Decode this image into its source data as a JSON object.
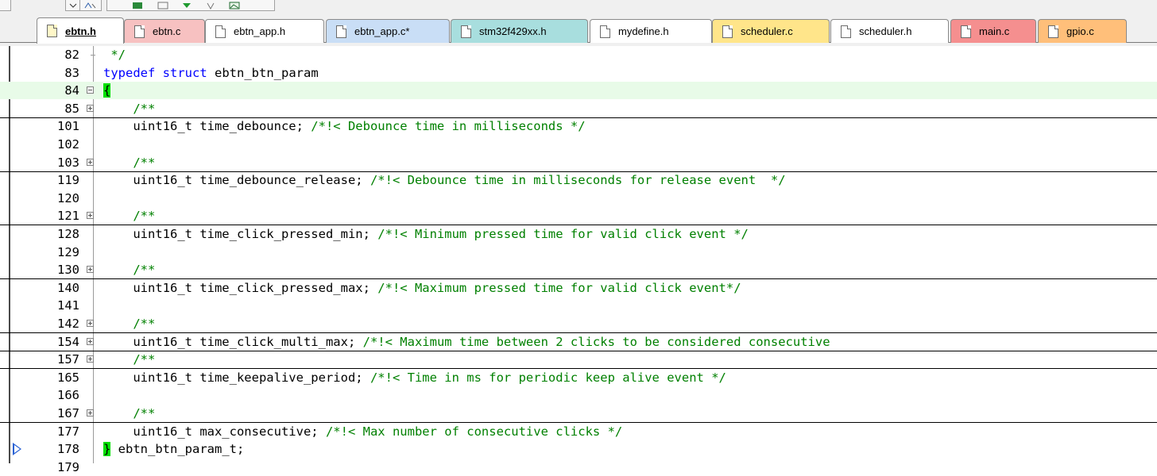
{
  "toolbar": {
    "buttons": [
      "dropdown-icon",
      "find-replace-icon",
      "window-icon",
      "tile-icon",
      "step-down-icon",
      "pin-icon",
      "image-icon"
    ]
  },
  "tabs": [
    {
      "label": "ebtn.h",
      "color": "#fffbf0",
      "active": true
    },
    {
      "label": "ebtn.c",
      "color": "#f7c1c1",
      "active": false
    },
    {
      "label": "ebtn_app.h",
      "color": "#ffffff",
      "active": false
    },
    {
      "label": "ebtn_app.c*",
      "color": "#c9def6",
      "active": false
    },
    {
      "label": "stm32f429xx.h",
      "color": "#a8dede",
      "active": false
    },
    {
      "label": "mydefine.h",
      "color": "#ffffff",
      "active": false
    },
    {
      "label": "scheduler.c",
      "color": "#ffe58a",
      "active": false
    },
    {
      "label": "scheduler.h",
      "color": "#ffffff",
      "active": false
    },
    {
      "label": "main.c",
      "color": "#f58f8f",
      "active": false
    },
    {
      "label": "gpio.c",
      "color": "#ffbf7a",
      "active": false
    }
  ],
  "editor": {
    "lines": [
      {
        "num": "82",
        "parts": [
          {
            "t": " */",
            "c": "cm"
          }
        ]
      },
      {
        "num": "83",
        "parts": [
          {
            "t": "typedef",
            "c": "kw"
          },
          {
            "t": " ",
            "c": ""
          },
          {
            "t": "struct",
            "c": "kw"
          },
          {
            "t": " ebtn_btn_param",
            "c": ""
          }
        ]
      },
      {
        "num": "84",
        "fold": "minus",
        "current": true,
        "parts": [
          {
            "t": "{",
            "c": "brace"
          }
        ]
      },
      {
        "num": "85",
        "fold": "plus",
        "hline": true,
        "parts": [
          {
            "t": "    /**",
            "c": "cm"
          }
        ]
      },
      {
        "num": "101",
        "parts": [
          {
            "t": "    uint16_t time_debounce; ",
            "c": ""
          },
          {
            "t": "/*!< Debounce time in milliseconds */",
            "c": "cm"
          }
        ]
      },
      {
        "num": "102",
        "parts": []
      },
      {
        "num": "103",
        "fold": "plus",
        "hline": true,
        "parts": [
          {
            "t": "    /**",
            "c": "cm"
          }
        ]
      },
      {
        "num": "119",
        "parts": [
          {
            "t": "    uint16_t time_debounce_release; ",
            "c": ""
          },
          {
            "t": "/*!< Debounce time in milliseconds for release event  */",
            "c": "cm"
          }
        ]
      },
      {
        "num": "120",
        "parts": []
      },
      {
        "num": "121",
        "fold": "plus",
        "hline": true,
        "parts": [
          {
            "t": "    /**",
            "c": "cm"
          }
        ]
      },
      {
        "num": "128",
        "parts": [
          {
            "t": "    uint16_t time_click_pressed_min; ",
            "c": ""
          },
          {
            "t": "/*!< Minimum pressed time for valid click event */",
            "c": "cm"
          }
        ]
      },
      {
        "num": "129",
        "parts": []
      },
      {
        "num": "130",
        "fold": "plus",
        "hline": true,
        "parts": [
          {
            "t": "    /**",
            "c": "cm"
          }
        ]
      },
      {
        "num": "140",
        "parts": [
          {
            "t": "    uint16_t time_click_pressed_max; ",
            "c": ""
          },
          {
            "t": "/*!< Maximum pressed time for valid click event*/",
            "c": "cm"
          }
        ]
      },
      {
        "num": "141",
        "parts": []
      },
      {
        "num": "142",
        "fold": "plus",
        "hline": true,
        "parts": [
          {
            "t": "    /**",
            "c": "cm"
          }
        ]
      },
      {
        "num": "154",
        "fold": "plus",
        "hline": true,
        "parts": [
          {
            "t": "    uint16_t time_click_multi_max; ",
            "c": ""
          },
          {
            "t": "/*!< Maximum time between 2 clicks to be considered consecutive",
            "c": "cm"
          }
        ]
      },
      {
        "num": "157",
        "fold": "plus",
        "hline": true,
        "parts": [
          {
            "t": "    /**",
            "c": "cm"
          }
        ]
      },
      {
        "num": "165",
        "parts": [
          {
            "t": "    uint16_t time_keepalive_period; ",
            "c": ""
          },
          {
            "t": "/*!< Time in ms for periodic keep alive event */",
            "c": "cm"
          }
        ]
      },
      {
        "num": "166",
        "parts": []
      },
      {
        "num": "167",
        "fold": "plus",
        "hline": true,
        "parts": [
          {
            "t": "    /**",
            "c": "cm"
          }
        ]
      },
      {
        "num": "177",
        "parts": [
          {
            "t": "    uint16_t max_consecutive; ",
            "c": ""
          },
          {
            "t": "/*!< Max number of consecutive clicks */",
            "c": "cm"
          }
        ]
      },
      {
        "num": "178",
        "marker": true,
        "parts": [
          {
            "t": "}",
            "c": "brace"
          },
          {
            "t": " ebtn_btn_param_t;",
            "c": ""
          }
        ]
      },
      {
        "num": "179",
        "parts": []
      }
    ]
  }
}
